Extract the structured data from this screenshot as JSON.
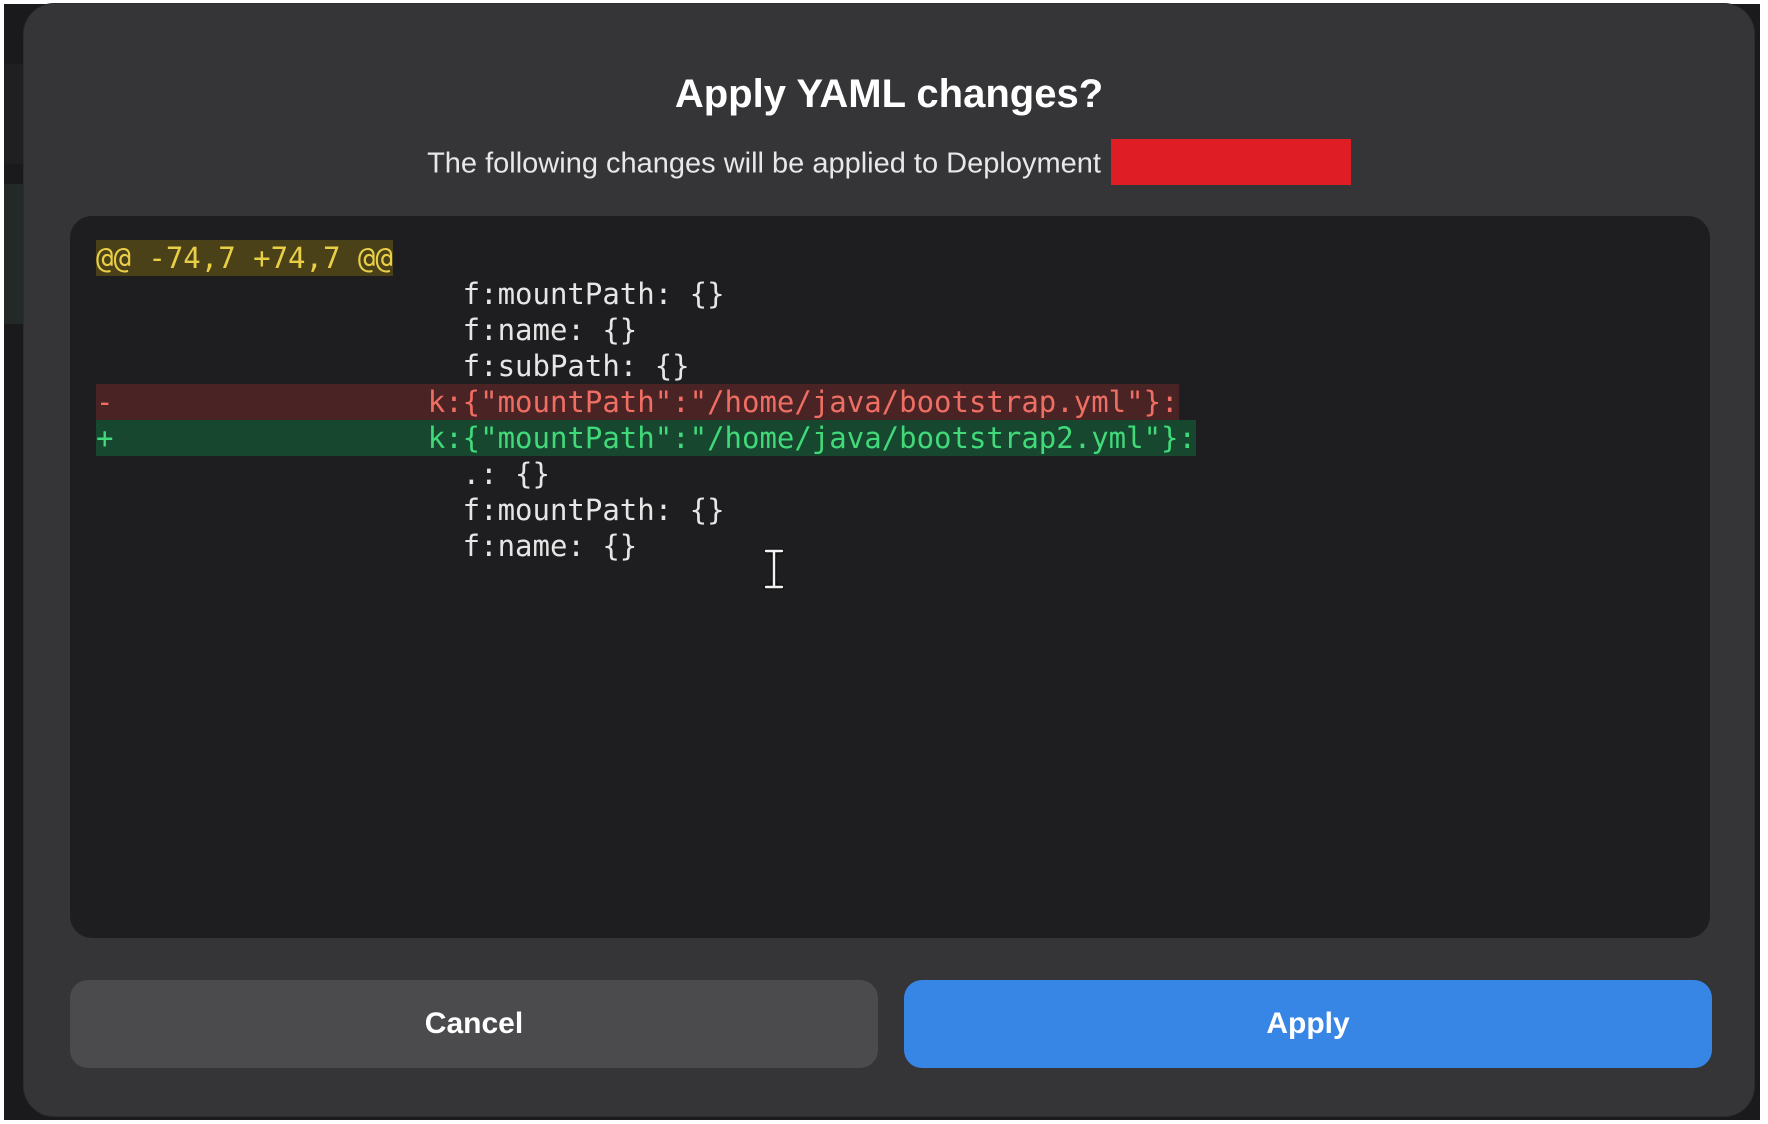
{
  "dialog": {
    "title": "Apply YAML changes?",
    "subtitle": "The following changes will be applied to Deployment",
    "redaction_color": "#de1d24"
  },
  "diff": {
    "hunk_header": "@@ -74,7 +74,7 @@",
    "lines": [
      {
        "type": "context",
        "prefix": " ",
        "text": "                    f:mountPath: {}"
      },
      {
        "type": "context",
        "prefix": " ",
        "text": "                    f:name: {}"
      },
      {
        "type": "context",
        "prefix": " ",
        "text": "                    f:subPath: {}"
      },
      {
        "type": "removed",
        "prefix": "-",
        "text": "                  k:{\"mountPath\":\"/home/java/bootstrap.yml\"}:"
      },
      {
        "type": "added",
        "prefix": "+",
        "text": "                  k:{\"mountPath\":\"/home/java/bootstrap2.yml\"}:"
      },
      {
        "type": "context",
        "prefix": " ",
        "text": "                    .: {}"
      },
      {
        "type": "context",
        "prefix": " ",
        "text": "                    f:mountPath: {}"
      },
      {
        "type": "context",
        "prefix": " ",
        "text": "                    f:name: {}"
      }
    ],
    "colors": {
      "hunk_text": "#e9cf47",
      "removed_text": "#ef6e64",
      "added_text": "#41d97a"
    }
  },
  "buttons": {
    "cancel_label": "Cancel",
    "apply_label": "Apply",
    "apply_color": "#3785e4"
  },
  "cursor": {
    "icon": "text-cursor-icon"
  }
}
